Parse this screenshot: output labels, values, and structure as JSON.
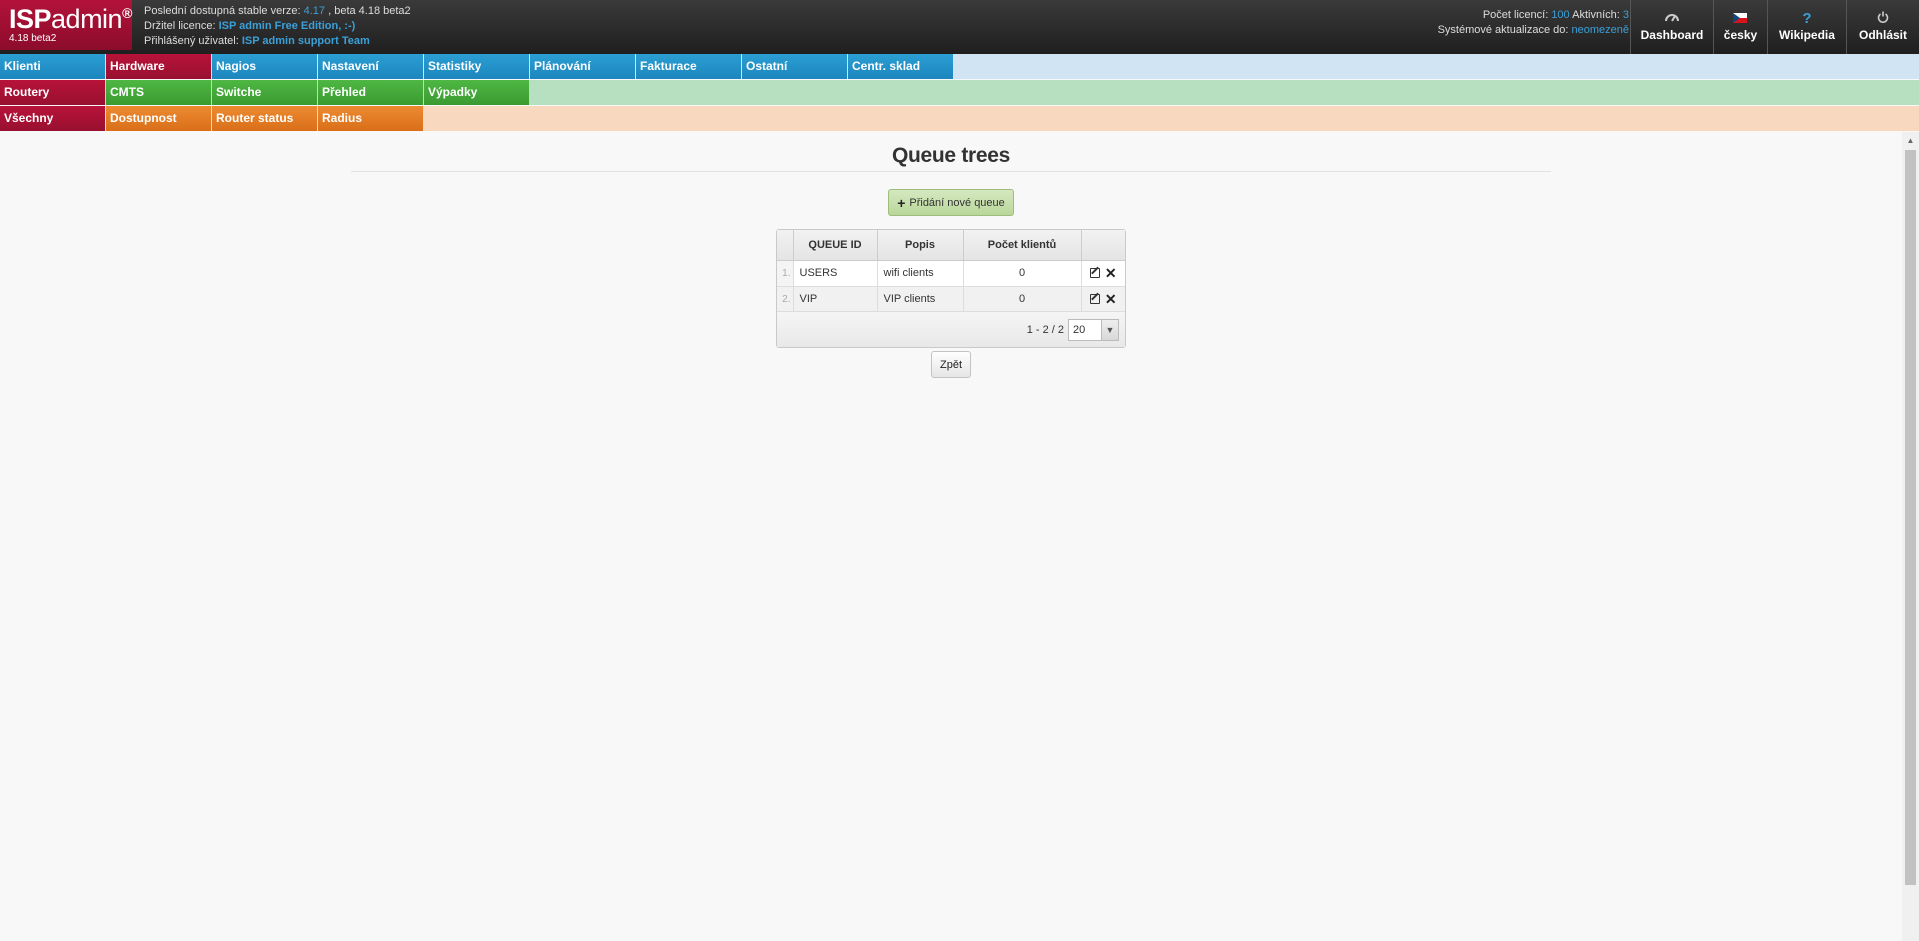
{
  "header": {
    "logo": {
      "brand_bold": "ISP",
      "brand_thin": "admin",
      "brand_mark": "®",
      "version": "4.18 beta2"
    },
    "info": {
      "stable_label": "Poslední dostupná stable verze:",
      "stable_version": "4.17",
      "beta_text": ", beta 4.18 beta2",
      "holder_label": "Držitel licence:",
      "holder_value": "ISP admin Free Edition, :-)",
      "user_label": "Přihlášený uživatel:",
      "user_value": "ISP admin support Team"
    },
    "license": {
      "count_label": "Počet licencí:",
      "count_value": "100",
      "active_label": "Aktivních:",
      "active_value": "3",
      "updates_label": "Systémové aktualizace do:",
      "updates_value": "neomezeně"
    },
    "buttons": {
      "dashboard": "Dashboard",
      "language": "česky",
      "wiki": "Wikipedia",
      "logout": "Odhlásit"
    }
  },
  "menu": {
    "row1": [
      "Klienti",
      "Hardware",
      "Nagios",
      "Nastavení",
      "Statistiky",
      "Plánování",
      "Fakturace",
      "Ostatní",
      "Centr. sklad"
    ],
    "row2": [
      "Routery",
      "CMTS",
      "Switche",
      "Přehled",
      "Výpadky"
    ],
    "row3": [
      "Všechny",
      "Dostupnost",
      "Router status",
      "Radius"
    ]
  },
  "page": {
    "title": "Queue trees",
    "add_button": "Přidání nové queue",
    "back_button": "Zpět"
  },
  "table": {
    "columns": [
      "QUEUE ID",
      "Popis",
      "Počet klientů"
    ],
    "rows": [
      {
        "num": "1.",
        "queue_id": "USERS",
        "popis": "wifi clients",
        "count": "0"
      },
      {
        "num": "2.",
        "queue_id": "VIP",
        "popis": "VIP clients",
        "count": "0"
      }
    ],
    "pager": {
      "range": "1 - 2 / 2",
      "page_size": "20"
    }
  },
  "colors": {
    "brand_red": "#a50f33",
    "menu_blue": "#2196cf",
    "menu_green": "#45a93a",
    "menu_orange": "#e47d24",
    "link_blue": "#3ba0d8"
  }
}
